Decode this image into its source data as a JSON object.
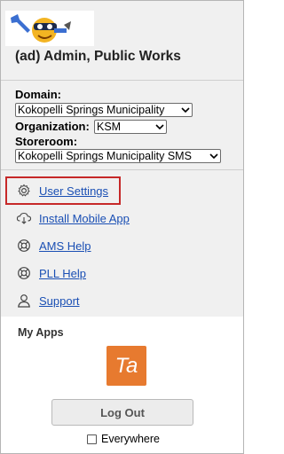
{
  "user": {
    "display_name": "(ad) Admin, Public Works"
  },
  "filters": {
    "domain_label": "Domain:",
    "domain_value": "Kokopelli Springs Municipality",
    "organization_label": "Organization:",
    "organization_value": "KSM",
    "storeroom_label": "Storeroom:",
    "storeroom_value": "Kokopelli Springs Municipality SMS"
  },
  "menu": {
    "items": [
      {
        "label": "User Settings",
        "icon": "gear-icon"
      },
      {
        "label": "Install Mobile App",
        "icon": "cloud-download-icon"
      },
      {
        "label": "AMS Help",
        "icon": "help-lifebuoy-icon"
      },
      {
        "label": "PLL Help",
        "icon": "help-lifebuoy-icon"
      },
      {
        "label": "Support",
        "icon": "person-icon"
      }
    ]
  },
  "apps": {
    "section_title": "My Apps",
    "tile_text": "Ta",
    "tile_color": "#e77a2f"
  },
  "logout": {
    "button_label": "Log Out",
    "everywhere_label": "Everywhere",
    "everywhere_checked": false
  }
}
